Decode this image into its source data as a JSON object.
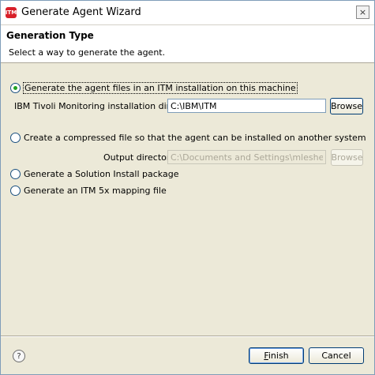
{
  "window": {
    "title": "Generate Agent Wizard",
    "close_icon": "×"
  },
  "header": {
    "title": "Generation Type",
    "description": "Select a way to generate the agent."
  },
  "options": {
    "itm_install": {
      "label": "Generate the agent files in an ITM installation on this machine",
      "selected": true,
      "dir_label": "IBM Tivoli Monitoring installation directory",
      "dir_value": "C:\\IBM\\ITM",
      "browse_label": "Browse"
    },
    "compressed": {
      "label": "Create a compressed file so that the agent can be installed on another system",
      "selected": false,
      "output_label": "Output directory",
      "output_value": "C:\\Documents and Settings\\mlesher",
      "browse_label": "Browse"
    },
    "solution_install": {
      "label": "Generate a Solution Install package",
      "selected": false
    },
    "mapping_file": {
      "label": "Generate an ITM 5x mapping file",
      "selected": false
    }
  },
  "footer": {
    "help_icon": "?",
    "finish_prefix": "",
    "finish_mnemonic": "F",
    "finish_rest": "inish",
    "cancel_label": "Cancel"
  }
}
